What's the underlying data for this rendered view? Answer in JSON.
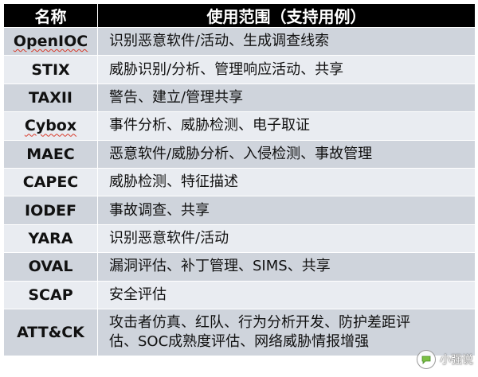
{
  "table": {
    "headers": [
      "名称",
      "使用范围（支持用例）"
    ],
    "rows": [
      {
        "name": "OpenIOC",
        "use": "识别恶意软件/活动、生成调查线索"
      },
      {
        "name": "STIX",
        "use": "威胁识别/分析、管理响应活动、共享"
      },
      {
        "name": "TAXII",
        "use": "警告、建立/管理共享"
      },
      {
        "name": "Cybox",
        "use": "事件分析、威胁检测、电子取证"
      },
      {
        "name": "MAEC",
        "use": "恶意软件/威胁分析、入侵检测、事故管理"
      },
      {
        "name": "CAPEC",
        "use": "威胁检测、特征描述"
      },
      {
        "name": "IODEF",
        "use": "事故调查、共享"
      },
      {
        "name": "YARA",
        "use": "识别恶意软件/活动"
      },
      {
        "name": "OVAL",
        "use": "漏洞评估、补丁管理、SIMS、共享"
      },
      {
        "name": "SCAP",
        "use": "安全评估"
      },
      {
        "name": "ATT&CK",
        "use_lines": [
          "攻击者仿真、红队、行为分析开发、防护差距评",
          "估、SOC成熟度评估、网络威胁情报增强"
        ]
      }
    ]
  },
  "watermark": {
    "text": "小强说",
    "icon": "chat-bubble-icon"
  },
  "colors": {
    "header_bg": "#000000",
    "row_dark": "#cfd4dc",
    "row_light": "#e9ecf1",
    "spell_underline": "#d83a2a"
  }
}
